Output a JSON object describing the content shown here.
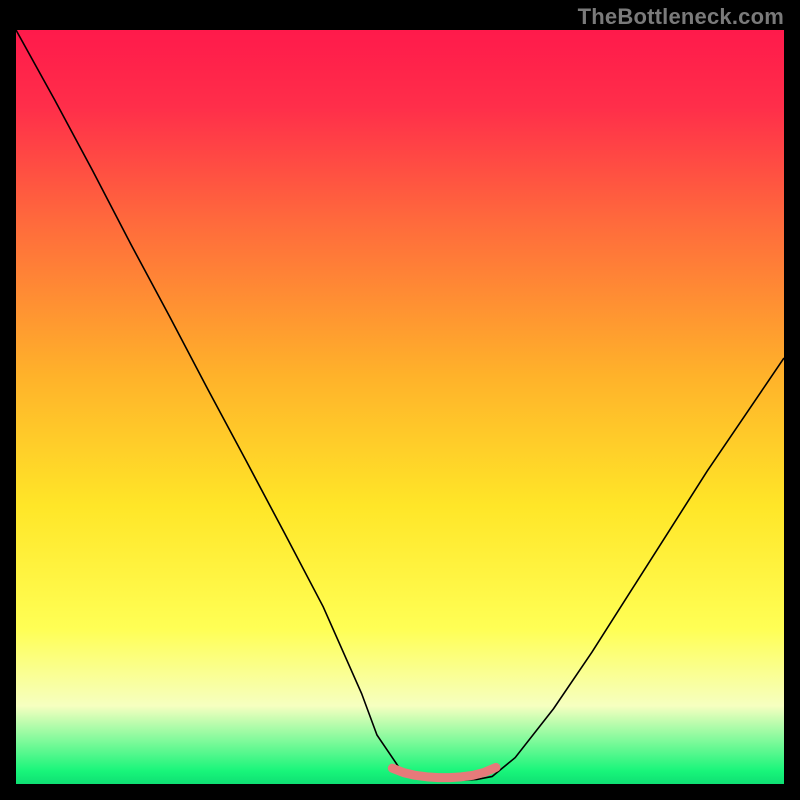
{
  "watermark": "TheBottleneck.com",
  "chart_data": {
    "type": "line",
    "title": "",
    "xlabel": "",
    "ylabel": "",
    "xlim": [
      0,
      100
    ],
    "ylim": [
      0,
      100
    ],
    "grid": false,
    "legend": "none",
    "gradient_stops": [
      {
        "pos": 0.0,
        "color": "#ff1a4b"
      },
      {
        "pos": 0.1,
        "color": "#ff2e4a"
      },
      {
        "pos": 0.25,
        "color": "#ff6a3c"
      },
      {
        "pos": 0.45,
        "color": "#ffb22a"
      },
      {
        "pos": 0.62,
        "color": "#ffe628"
      },
      {
        "pos": 0.78,
        "color": "#ffff55"
      },
      {
        "pos": 0.88,
        "color": "#f6ffc0"
      },
      {
        "pos": 0.965,
        "color": "#18f57a"
      },
      {
        "pos": 1.0,
        "color": "#05c86c"
      }
    ],
    "series": [
      {
        "name": "curve-black",
        "color": "#000000",
        "x": [
          0,
          5,
          10,
          15,
          20,
          25,
          30,
          35,
          40,
          45,
          47,
          50,
          53,
          58,
          60,
          62,
          65,
          70,
          75,
          80,
          85,
          90,
          95,
          100
        ],
        "y": [
          100,
          90.8,
          81.3,
          71.5,
          62.0,
          52.3,
          42.8,
          33.2,
          23.5,
          12.0,
          6.5,
          2.0,
          0.8,
          0.5,
          0.6,
          1.0,
          3.5,
          10.0,
          17.5,
          25.5,
          33.5,
          41.5,
          49.0,
          56.5
        ]
      },
      {
        "name": "well-marker",
        "color": "#e67a7a",
        "x": [
          49,
          50.5,
          52,
          53.5,
          55,
          56.5,
          58,
          59.5,
          61,
          62.5
        ],
        "y": [
          2.1,
          1.5,
          1.15,
          0.95,
          0.85,
          0.85,
          0.95,
          1.15,
          1.55,
          2.2
        ]
      }
    ]
  }
}
